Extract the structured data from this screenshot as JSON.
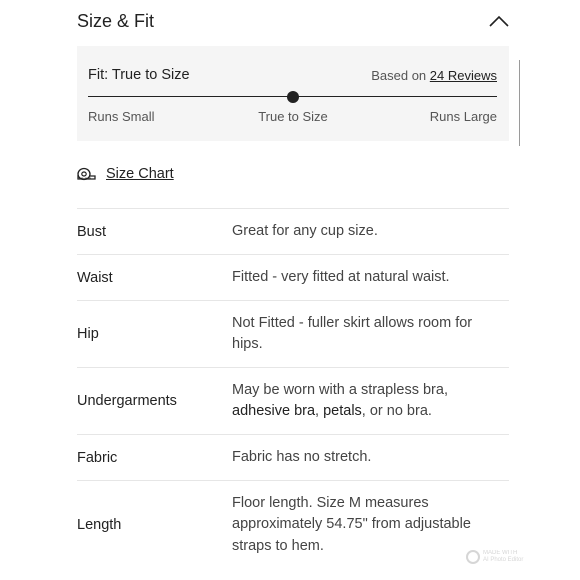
{
  "section": {
    "title": "Size & Fit",
    "toggle_icon": "chevron-up-icon"
  },
  "fit": {
    "label": "Fit: True to Size",
    "reviews_prefix": "Based on",
    "reviews_link": "24 Reviews",
    "scale": {
      "small": "Runs Small",
      "mid": "True to Size",
      "large": "Runs Large"
    },
    "position": 0.5
  },
  "size_chart": {
    "label": "Size Chart",
    "icon": "measuring-tape-icon"
  },
  "rows": [
    {
      "key": "Bust",
      "value": "Great for any cup size."
    },
    {
      "key": "Waist",
      "value": "Fitted - very fitted at natural waist."
    },
    {
      "key": "Hip",
      "value": "Not Fitted - fuller skirt allows room for hips."
    },
    {
      "key": "Undergarments",
      "parts": [
        "May be worn with a strapless bra, ",
        "adhesive bra",
        ", ",
        "petals",
        ", or no bra."
      ]
    },
    {
      "key": "Fabric",
      "value": "Fabric has no stretch."
    },
    {
      "key": "Length",
      "value": "Floor length. Size M measures approximately 54.75\" from adjustable straps to hem."
    }
  ],
  "watermark": {
    "line1": "MADE WITH",
    "line2": "AI Photo Editor"
  }
}
